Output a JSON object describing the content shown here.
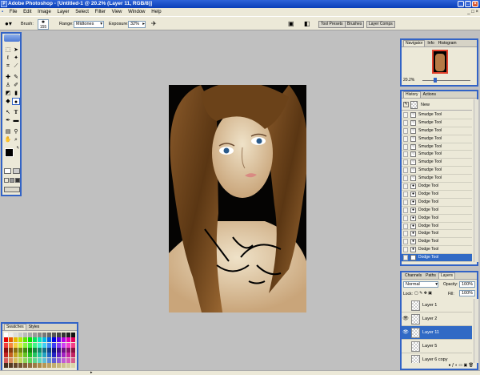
{
  "app": {
    "title": "Adobe Photoshop - [Untitled-1 @ 20.2% (Layer 11, RGB/8)]"
  },
  "menu": [
    "File",
    "Edit",
    "Image",
    "Layer",
    "Select",
    "Filter",
    "View",
    "Window",
    "Help"
  ],
  "options": {
    "brush_label": "Brush:",
    "brush_size": "155",
    "range_label": "Range:",
    "range_value": "Midtones",
    "exposure_label": "Exposure:",
    "exposure_value": "32%",
    "palette_tabs": [
      "Tool Presets",
      "Brushes",
      "Layer Comps"
    ]
  },
  "navigator": {
    "tabs": [
      "Navigator",
      "Info",
      "Histogram"
    ],
    "zoom": "20.2%"
  },
  "history": {
    "tabs": [
      "History",
      "Actions"
    ],
    "snapshot_label": "New",
    "items": [
      "Smudge Tool",
      "Smudge Tool",
      "Smudge Tool",
      "Smudge Tool",
      "Smudge Tool",
      "Smudge Tool",
      "Smudge Tool",
      "Smudge Tool",
      "Smudge Tool",
      "Dodge Tool",
      "Dodge Tool",
      "Dodge Tool",
      "Dodge Tool",
      "Dodge Tool",
      "Dodge Tool",
      "Dodge Tool",
      "Dodge Tool",
      "Dodge Tool",
      "Dodge Tool"
    ],
    "selected_index": 18
  },
  "layers": {
    "tabs": [
      "Channels",
      "Paths",
      "Layers"
    ],
    "blend_mode": "Normal",
    "opacity_label": "Opacity:",
    "opacity": "100%",
    "lock_label": "Lock:",
    "fill_label": "Fill:",
    "fill": "100%",
    "items": [
      "Layer 1",
      "Layer 2",
      "Layer 11",
      "Layer 5",
      "Layer 6 copy"
    ],
    "selected_index": 2
  },
  "swatches": {
    "tabs": [
      "Swatches",
      "Styles"
    ]
  },
  "colors": {
    "accent": "#3263c6",
    "selection": "#316ac5",
    "foreground": "#000000",
    "background": "#4a2b14"
  },
  "icons": {
    "dodge": "dodge-tool-icon",
    "smudge": "smudge-tool-icon",
    "eye": "eye-icon"
  }
}
